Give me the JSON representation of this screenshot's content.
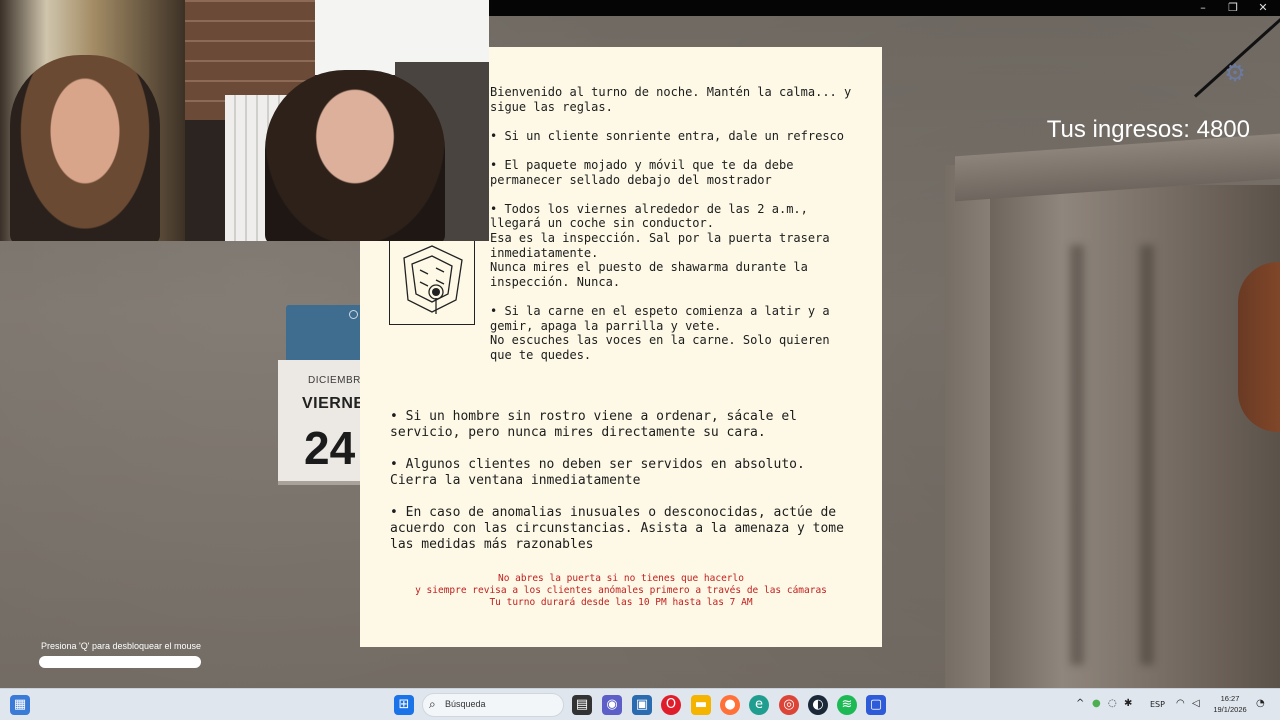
{
  "hud": {
    "income_text": "Tus ingresos: 4800",
    "unlock_hint": "Presiona 'Q' para desbloquear el mouse"
  },
  "window_controls": {
    "minimize": "–",
    "restore": "❐",
    "close": "✕"
  },
  "calendar": {
    "month": "DICIEMBRE",
    "weekday": "VIERNES",
    "day": "24"
  },
  "rules": {
    "top": [
      "Bienvenido al turno de noche. Mantén la calma... y\nsigue las reglas.",
      "• Si un cliente sonriente entra, dale un refresco",
      "• El paquete mojado y móvil que te da debe\npermanecer sellado debajo del mostrador",
      "• Todos los viernes alrededor de las 2 a.m.,\nllegará un coche sin conductor.\nEsa es la inspección. Sal por la puerta trasera\ninmediatamente.\nNunca mires el puesto de shawarma durante la\ninspección. Nunca.",
      "• Si la carne en el espeto comienza a latir y a\ngemir, apaga la parrilla y vete.\nNo escuches las voces en la carne. Solo quieren\nque te quedes."
    ],
    "bottom": [
      "• Si un hombre sin rostro viene a ordenar, sácale el\nservicio, pero nunca mires directamente su cara.",
      "• Algunos clientes no deben ser servidos en absoluto.\nCierra la ventana inmediatamente",
      "• En caso de anomalias inusuales o desconocidas, actúe de\nacuerdo con las circunstancias. Asista a la amenaza y tome\nlas medidas más razonables"
    ],
    "warning": [
      "No abres la puerta si no tienes que hacerlo",
      "y siempre revisa a los clientes anómales primero a través de las cámaras",
      "Tu turno durará desde las 10 PM hasta las 7 AM"
    ]
  },
  "taskbar": {
    "search_placeholder": "Búsqueda",
    "language": "ESP",
    "time": "16:27",
    "date": "19/1/2026",
    "apps": [
      "widgets-icon",
      "start-icon",
      "search-icon",
      "file-icon",
      "chat-icon",
      "store-icon",
      "opera-icon",
      "folder-icon",
      "firefox-icon",
      "edge-icon",
      "chrome-icon",
      "steam-icon",
      "spotify-icon",
      "game-icon"
    ]
  },
  "colors": {
    "paper": "#fdf9e6",
    "warning_red": "#c22020",
    "taskbar": "#dfe6ee"
  }
}
